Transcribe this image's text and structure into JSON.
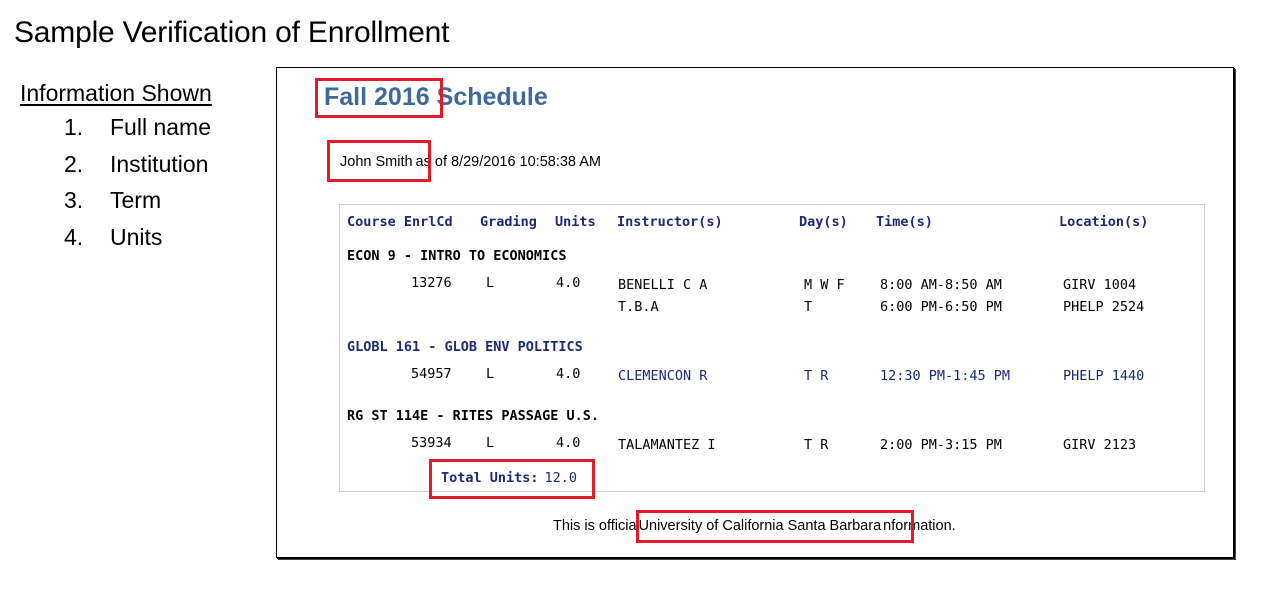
{
  "page_title": "Sample Verification of Enrollment",
  "info": {
    "heading": "Information Shown",
    "items": [
      {
        "num": "1.",
        "label": "Full name"
      },
      {
        "num": "2.",
        "label": "Institution"
      },
      {
        "num": "3.",
        "label": "Term"
      },
      {
        "num": "4.",
        "label": "Units"
      }
    ]
  },
  "schedule": {
    "term": "Fall 2016",
    "title_suffix": "Schedule",
    "student_name": "John Smith",
    "as_of": "as of 8/29/2016 10:58:38 AM",
    "headers": [
      "Course EnrlCd",
      "Grading",
      "Units",
      "Instructor(s)",
      "Day(s)",
      "Time(s)",
      "Location(s)"
    ],
    "courses": [
      {
        "title": "ECON 9 - INTRO TO ECONOMICS",
        "enrl_code": "13276",
        "grading": "L",
        "units": "4.0",
        "sessions": [
          {
            "instructor": "BENELLI C A",
            "days": "M W F",
            "time": "8:00 AM-8:50 AM",
            "location": "GIRV 1004"
          },
          {
            "instructor": "T.B.A",
            "days": "T",
            "time": "6:00 PM-6:50 PM",
            "location": "PHELP 2524"
          }
        ]
      },
      {
        "title": "GLOBL 161 - GLOB ENV POLITICS",
        "enrl_code": "54957",
        "grading": "L",
        "units": "4.0",
        "sessions": [
          {
            "instructor": "CLEMENCON R",
            "days": "T R",
            "time": "12:30 PM-1:45 PM",
            "location": "PHELP 1440"
          }
        ]
      },
      {
        "title": "RG ST 114E - RITES PASSAGE U.S.",
        "enrl_code": "53934",
        "grading": "L",
        "units": "4.0",
        "sessions": [
          {
            "instructor": "TALAMANTEZ I",
            "days": "T R",
            "time": "2:00 PM-3:15 PM",
            "location": "GIRV 2123"
          }
        ]
      }
    ],
    "total_units_label": "Total Units:",
    "total_units": "12.0",
    "footer_prefix": "This is officia",
    "institution": "University of California Santa Barbara",
    "footer_suffix": "nformation."
  },
  "colors": {
    "highlight": "#e11b2a",
    "title_blue": "#3d6a9a",
    "header_navy": "#1c2a78"
  }
}
